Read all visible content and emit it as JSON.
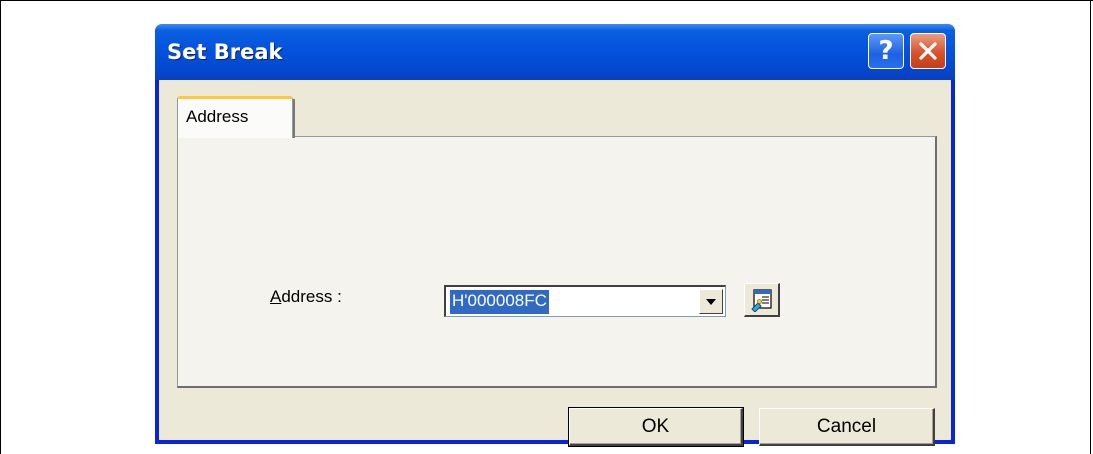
{
  "window": {
    "title": "Set Break",
    "help_label": "?",
    "close_label": "✕"
  },
  "tabs": [
    {
      "label": "Address"
    }
  ],
  "form": {
    "address_label": "Address :",
    "address_value": "H'000008FC"
  },
  "buttons": {
    "ok_label": "OK",
    "cancel_label": "Cancel"
  },
  "colors": {
    "title_bar": "#0453dd",
    "selection": "#316ac5",
    "dialog_face": "#ece9d8"
  }
}
